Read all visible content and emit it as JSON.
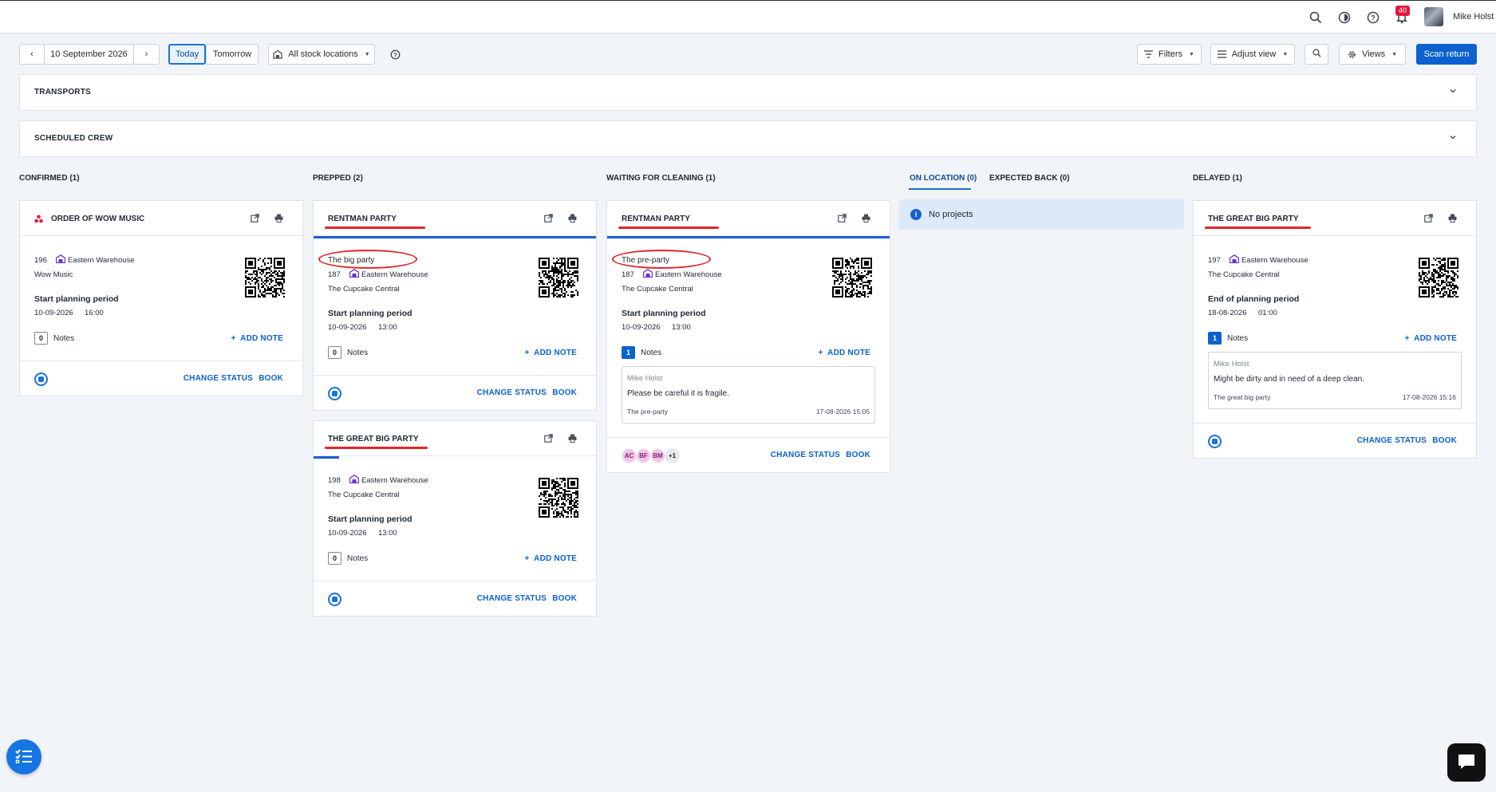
{
  "user": {
    "name": "Mike Holst",
    "notification_count": "40"
  },
  "toolbar": {
    "date": "10 September 2026",
    "today": "Today",
    "tomorrow": "Tomorrow",
    "locations": "All stock locations",
    "filters": "Filters",
    "adjust_view": "Adjust view",
    "views": "Views",
    "scan_return": "Scan return"
  },
  "panels": {
    "transports": "TRANSPORTS",
    "scheduled_crew": "SCHEDULED CREW"
  },
  "columns": {
    "confirmed": "CONFIRMED (1)",
    "prepped": "PREPPED (2)",
    "waiting": "WAITING FOR CLEANING (1)",
    "on_location": "ON LOCATION (0)",
    "expected_back": "EXPECTED BACK (0)",
    "delayed": "DELAYED (1)"
  },
  "labels": {
    "notes": "Notes",
    "add_note": "ADD NOTE",
    "change_status": "CHANGE STATUS",
    "book": "BOOK",
    "no_projects": "No projects"
  },
  "cards": {
    "confirmed_1": {
      "title": "ORDER OF WOW MUSIC",
      "number": "196",
      "warehouse": "Eastern Warehouse",
      "client": "Wow Music",
      "period_label": "Start planning period",
      "date": "10-09-2026",
      "time": "16:00",
      "notes_count": "0"
    },
    "prepped_1": {
      "title": "RENTMAN PARTY",
      "subtitle": "The big party",
      "number": "187",
      "warehouse": "Eastern Warehouse",
      "client": "The Cupcake Central",
      "period_label": "Start planning period",
      "date": "10-09-2026",
      "time": "13:00",
      "notes_count": "0",
      "progress": 1.0
    },
    "prepped_2": {
      "title": "THE GREAT BIG PARTY",
      "number": "198",
      "warehouse": "Eastern Warehouse",
      "client": "The Cupcake Central",
      "period_label": "Start planning period",
      "date": "10-09-2026",
      "time": "13:00",
      "notes_count": "0",
      "progress": 0.09
    },
    "waiting_1": {
      "title": "RENTMAN PARTY",
      "subtitle": "The pre-party",
      "number": "187",
      "warehouse": "Eastern Warehouse",
      "client": "The Cupcake Central",
      "period_label": "Start planning period",
      "date": "10-09-2026",
      "time": "13:00",
      "notes_count": "1",
      "progress": 1.0,
      "note": {
        "author": "Mike Holst",
        "text": "Please be careful it is fragile.",
        "project": "The pre-party",
        "date": "17-08-2026 15:05"
      },
      "crew": [
        "AC",
        "BF",
        "BM"
      ],
      "crew_more": "+1"
    },
    "delayed_1": {
      "title": "THE GREAT BIG PARTY",
      "number": "197",
      "warehouse": "Eastern Warehouse",
      "client": "The Cupcake Central",
      "period_label": "End of planning period",
      "date": "18-08-2026",
      "time": "01:00",
      "notes_count": "1",
      "note": {
        "author": "Mike Holst",
        "text": "Might be dirty and in need of a deep clean.",
        "project": "The great big party",
        "date": "17-08-2026 15:16"
      }
    }
  },
  "colors": {
    "accent": "#0b61d0",
    "annotation_red": "#e0262b",
    "warehouse_icon": "#6a2fd0"
  }
}
